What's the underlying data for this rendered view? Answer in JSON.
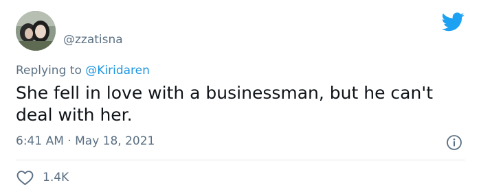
{
  "user": {
    "display_name": "ㅤㅤㅤㅤ",
    "handle": "@zzatisna"
  },
  "reply": {
    "prefix": "Replying to ",
    "mention": "@Kiridaren"
  },
  "tweet": {
    "text": "She fell in love with a businessman, but he can't deal with her.",
    "time": "6:41 AM",
    "separator": " · ",
    "date": "May 18, 2021"
  },
  "engagement": {
    "likes": "1.4K"
  },
  "colors": {
    "brand_blue": "#1da1f2",
    "secondary_text": "#5b7083",
    "mention_blue": "#1b95e0",
    "divider": "#e1e8ed"
  },
  "icons": {
    "brand": "twitter-bird-icon",
    "info": "info-icon",
    "like": "heart-icon"
  }
}
